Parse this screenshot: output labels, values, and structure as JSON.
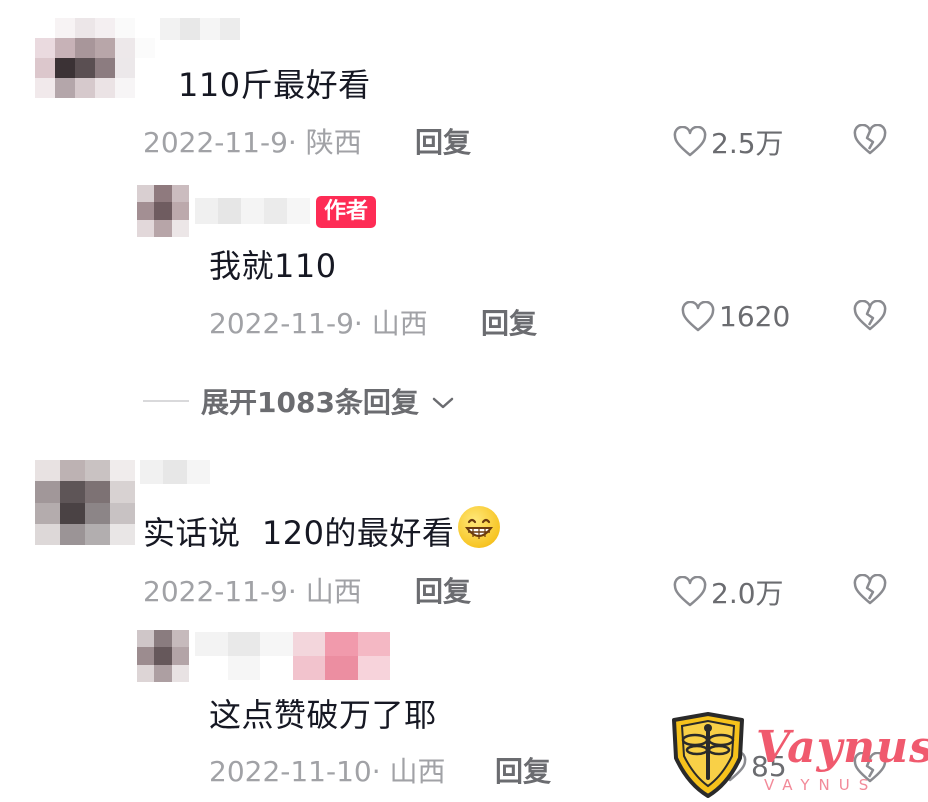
{
  "comments": [
    {
      "text": "110斤最好看",
      "meta": "2022-11-9· 陕西",
      "reply_label": "回复",
      "likes": "2.5万",
      "reply": {
        "badge": "作者",
        "text": "我就110",
        "meta": "2022-11-9· 山西",
        "reply_label": "回复",
        "likes": "1620"
      },
      "expand_label": "展开1083条回复"
    },
    {
      "text": "实话说  120的最好看",
      "meta": "2022-11-9· 山西",
      "reply_label": "回复",
      "likes": "2.0万",
      "reply": {
        "text": "这点赞破万了耶",
        "meta": "2022-11-10· 山西",
        "reply_label": "回复",
        "likes": "85"
      }
    }
  ],
  "icons": [
    "heart-outline-icon",
    "broken-heart-icon",
    "chevron-down-icon",
    "grin-emoji"
  ],
  "watermark": {
    "brand": "Vaynus",
    "sub": "VAYNUS"
  },
  "colors": {
    "badge": "#fe2c55",
    "text": "#161823",
    "meta": "#a1a2a6",
    "watermark": "#f05a6e"
  }
}
